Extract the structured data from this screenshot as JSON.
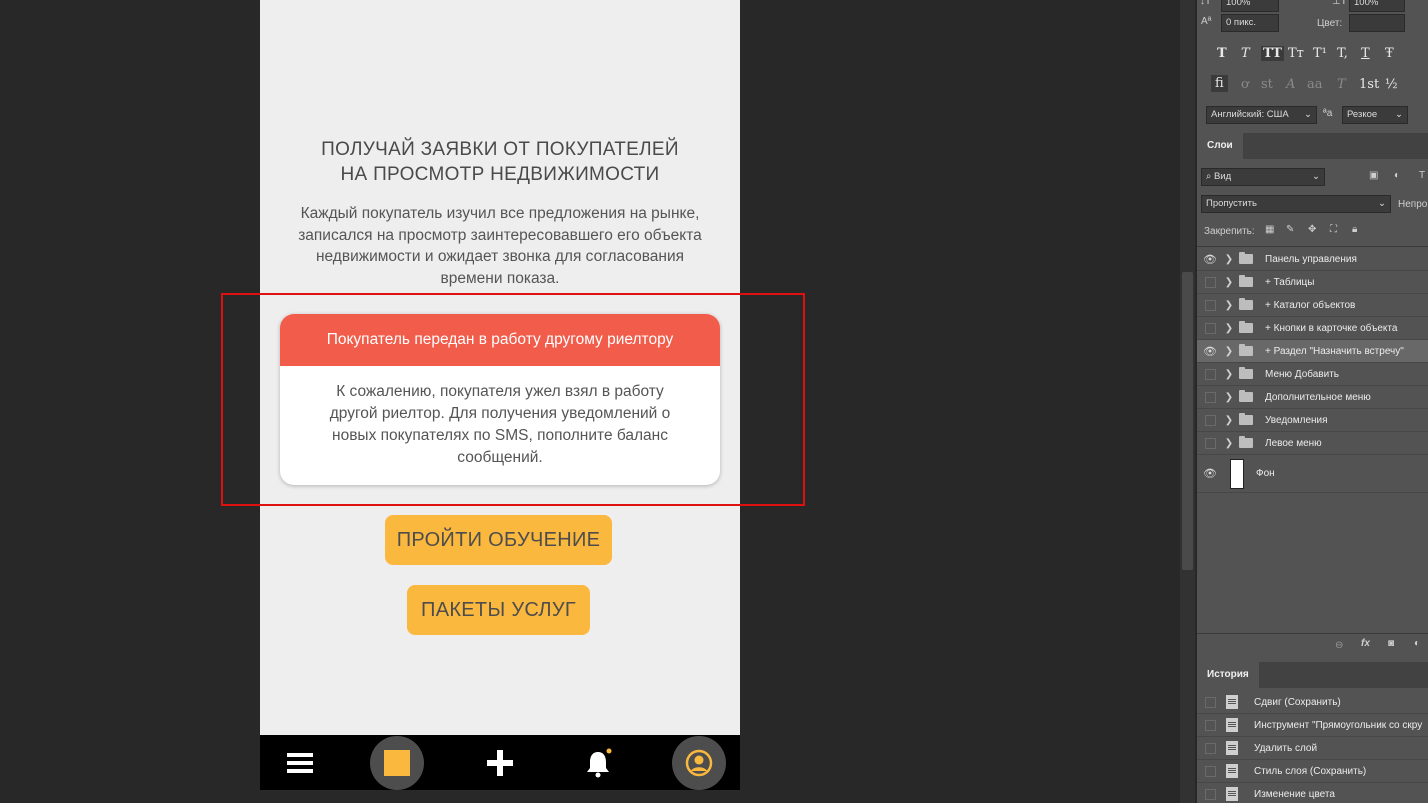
{
  "mockup": {
    "heading_line1": "ПОЛУЧАЙ ЗАЯВКИ ОТ ПОКУПАТЕЛЕЙ",
    "heading_line2": "НА ПРОСМОТР НЕДВИЖИМОСТИ",
    "intro_lines": [
      "Каждый покупатель изучил все предложения на рынке,",
      "записался на просмотр заинтересовавшего его объекта",
      "недвижимости и ожидает звонка для согласования",
      "времени показа."
    ],
    "card_title": "Покупатель передан в работу другому риелтору",
    "card_lines": [
      "К сожалению, покупателя ужел взял в работу",
      "другой риелтор. Для получения уведомлений о",
      "новых покупателях по SMS, пополните баланс",
      "сообщений."
    ],
    "btn_training": "ПРОЙТИ ОБУЧЕНИЕ",
    "btn_packages": "ПАКЕТЫ УСЛУГ",
    "tabbar_icons": [
      "hamburger-icon",
      "square-icon",
      "plus-icon",
      "bell-icon",
      "user-icon"
    ]
  },
  "colors": {
    "accent_red": "#f25c4a",
    "accent_yellow": "#fbb83e",
    "highlight_frame": "#e01010"
  },
  "character_panel": {
    "leading_value": "100%",
    "tracking_value": "100%",
    "baseline_value": "0 пикс.",
    "color_label": "Цвет:",
    "style_glyphs": [
      "T",
      "T",
      "TT",
      "Tт",
      "T¹",
      "T,",
      "T",
      "Ŧ"
    ],
    "opentype_glyphs": [
      "fi",
      "ơ",
      "st",
      "A",
      "aa",
      "T",
      "1st",
      "½"
    ],
    "language": "Английский: США",
    "aa_label": "ªa",
    "antialias": "Резкое"
  },
  "layers_panel": {
    "tab_label": "Слои",
    "filter_label": "Вид",
    "blend_mode": "Пропустить",
    "opacity_label": "Непро",
    "lock_label": "Закрепить:",
    "layers": [
      {
        "name": "Панель управления",
        "visible": true,
        "selected": false
      },
      {
        "name": "+ Таблицы",
        "visible": false,
        "selected": false
      },
      {
        "name": "+ Каталог объектов",
        "visible": false,
        "selected": false
      },
      {
        "name": "+ Кнопки в карточке объекта",
        "visible": false,
        "selected": false
      },
      {
        "name": "+ Раздел \"Назначить встречу\"",
        "visible": true,
        "selected": true
      },
      {
        "name": "Меню Добавить",
        "visible": false,
        "selected": false
      },
      {
        "name": "Дополнительное меню",
        "visible": false,
        "selected": false
      },
      {
        "name": "Уведомления",
        "visible": false,
        "selected": false
      },
      {
        "name": "Левое меню",
        "visible": false,
        "selected": false
      }
    ],
    "background_layer": "Фон"
  },
  "history_panel": {
    "tab_label": "История",
    "items": [
      "Сдвиг (Сохранить)",
      "Инструмент \"Прямоугольник со скру",
      "Удалить слой",
      "Стиль слоя (Сохранить)",
      "Изменение цвета"
    ]
  }
}
